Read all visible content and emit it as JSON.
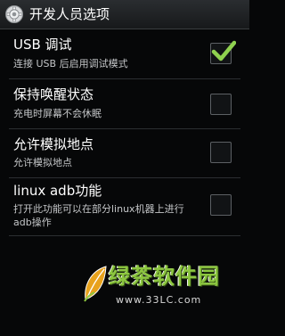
{
  "header": {
    "title": "开发人员选项",
    "icon": "settings-gear-icon"
  },
  "settings": [
    {
      "title": "USB 调试",
      "summary": "连接 USB 后启用调试模式",
      "checked": true
    },
    {
      "title": "保持唤醒状态",
      "summary": "充电时屏幕不会休眠",
      "checked": false
    },
    {
      "title": "允许模拟地点",
      "summary": "允许模拟地点",
      "checked": false
    },
    {
      "title": "linux adb功能",
      "summary": "打开此功能可以在部分linux机器上进行adb操作",
      "checked": false
    }
  ],
  "watermark": {
    "name": "绿茶软件园",
    "url": "www.33LC.com"
  },
  "colors": {
    "background": "#060708",
    "checkmark": "#8fd14f",
    "watermark_green": "#8cc63f"
  }
}
